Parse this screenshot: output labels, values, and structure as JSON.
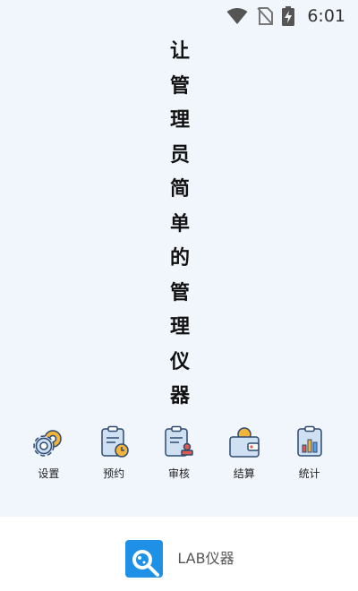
{
  "status_bar": {
    "time": "6:01",
    "icons": [
      "wifi-icon",
      "no-sim-icon",
      "battery-charging-icon"
    ]
  },
  "splash": {
    "title_chars": [
      "让",
      "管",
      "理",
      "员",
      "简",
      "单",
      "的",
      "管",
      "理",
      "仪",
      "器"
    ]
  },
  "menu": {
    "items": [
      {
        "label": "设置",
        "icon": "gear-icon"
      },
      {
        "label": "预约",
        "icon": "calendar-clock-icon"
      },
      {
        "label": "审核",
        "icon": "review-stamp-icon"
      },
      {
        "label": "结算",
        "icon": "wallet-icon"
      },
      {
        "label": "统计",
        "icon": "statistics-chart-icon"
      }
    ]
  },
  "footer": {
    "app_name": "LAB仪器",
    "logo": "lab-magnifier-logo-icon"
  },
  "colors": {
    "background": "#f1f6fd",
    "footer_bg": "#ffffff",
    "accent_blue": "#1e90e6",
    "icon_fill": "#cfe0f3",
    "icon_stroke": "#2d4a6e",
    "icon_orange": "#f3b43c"
  }
}
